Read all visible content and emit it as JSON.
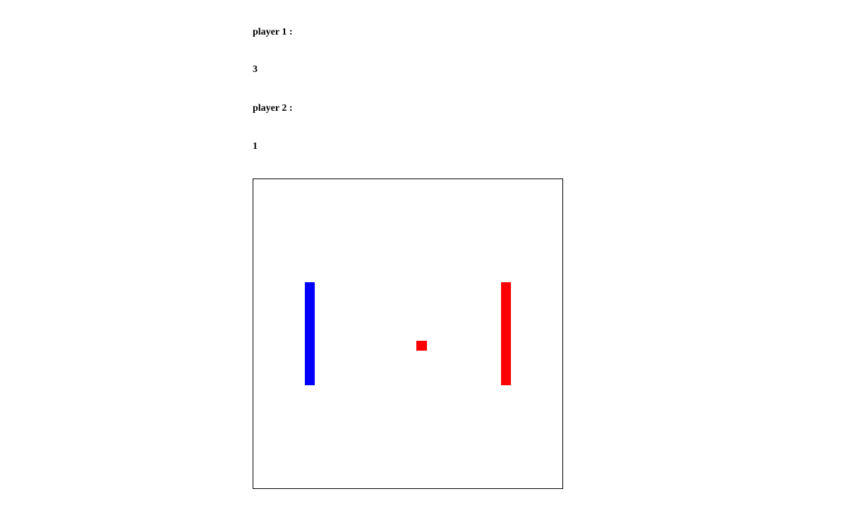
{
  "scoreboard": {
    "player1_label": "player 1 :",
    "player1_score": "3",
    "player2_label": "player 2 :",
    "player2_score": "1"
  },
  "game": {
    "left_paddle_color": "#0000ff",
    "right_paddle_color": "#ff0000",
    "ball_color": "#ff0000",
    "board_border_color": "#000000"
  }
}
